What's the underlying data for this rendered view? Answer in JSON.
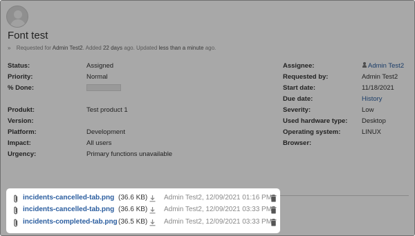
{
  "issue": {
    "title": "Font test",
    "meta": {
      "bullet": "»",
      "requested_prefix": "Requested for",
      "requested_for": "Admin Test2",
      "added_prefix": ". Added",
      "added": "22 days",
      "updated_prefix": "ago. Updated",
      "updated": "less than a minute",
      "suffix": "ago."
    },
    "left_fields": [
      {
        "label": "Status:",
        "value": "Assigned"
      },
      {
        "label": "Priority:",
        "value": "Normal"
      },
      {
        "label": "% Done:",
        "value": ""
      },
      {
        "label": "Produkt:",
        "value": "Test product 1"
      },
      {
        "label": "Version:",
        "value": ""
      },
      {
        "label": "Platform:",
        "value": "Development"
      },
      {
        "label": "Impact:",
        "value": "All users"
      },
      {
        "label": "Urgency:",
        "value": "Primary functions unavailable"
      }
    ],
    "done_percent": 0,
    "right_fields": [
      {
        "label": "Assignee:",
        "value": "Admin Test2"
      },
      {
        "label": "Requested by:",
        "value": "Admin Test2"
      },
      {
        "label": "Start date:",
        "value": "11/18/2021"
      },
      {
        "label": "Due date:",
        "value": "History"
      },
      {
        "label": "Severity:",
        "value": "Low"
      },
      {
        "label": "Used hardware type:",
        "value": "Desktop"
      },
      {
        "label": "Operating system:",
        "value": "LINUX"
      },
      {
        "label": "Browser:",
        "value": ""
      }
    ]
  },
  "attachments": [
    {
      "filename": "incidents-cancelled-tab.png",
      "size": "(36.6 KB)",
      "author": "Admin Test2, 12/09/2021 01:16 PM"
    },
    {
      "filename": "incidents-cancelled-tab.png",
      "size": "(36.6 KB)",
      "author": "Admin Test2, 12/09/2021 03:33 PM"
    },
    {
      "filename": "incidents-completed-tab.png",
      "size": "(36.5 KB)",
      "author": "Admin Test2, 12/09/2021 03:33 PM"
    }
  ],
  "icons": {
    "attachment": "paperclip-icon",
    "download": "download-icon",
    "delete": "trash-icon",
    "assignee": "user-icon"
  },
  "colors": {
    "link": "#2a5d9f",
    "overlay": "rgba(0,0,0,0.34)"
  }
}
